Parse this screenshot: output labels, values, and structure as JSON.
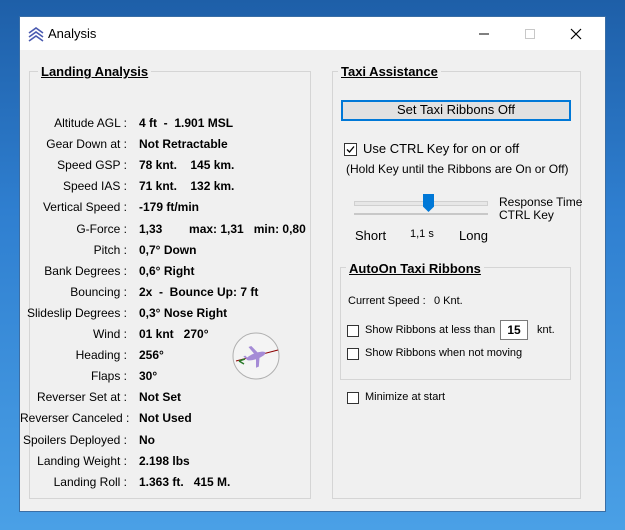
{
  "window": {
    "title": "Analysis"
  },
  "landing": {
    "title": "Landing Analysis",
    "rows": [
      {
        "label": "Altitude AGL :",
        "value": "4 ft  -  1.901 MSL"
      },
      {
        "label": "Gear Down at :",
        "value": "Not Retractable"
      },
      {
        "label": "Speed GSP :",
        "value": "78 knt.    145 km."
      },
      {
        "label": "Speed IAS :",
        "value": "71 knt.    132 km."
      },
      {
        "label": "Vertical Speed :",
        "value": "-179 ft/min"
      },
      {
        "label": "G-Force :",
        "value": "1,33        max: 1,31   min: 0,80"
      },
      {
        "label": "Pitch :",
        "value": "0,7° Down"
      },
      {
        "label": "Bank Degrees :",
        "value": "0,6° Right"
      },
      {
        "label": "Bouncing :",
        "value": "2x  -  Bounce Up: 7 ft"
      },
      {
        "label": "Slideslip Degrees :",
        "value": "0,3° Nose Right"
      },
      {
        "label": "Wind :",
        "value": "01 knt   270°"
      },
      {
        "label": "Heading :",
        "value": "256°"
      },
      {
        "label": "Flaps :",
        "value": "30°"
      },
      {
        "label": "Reverser Set at :",
        "value": "Not Set"
      },
      {
        "label": "Reverser Canceled :",
        "value": "Not Used"
      },
      {
        "label": "Spoilers Deployed :",
        "value": "No"
      },
      {
        "label": "Landing Weight :",
        "value": "2.198 lbs"
      },
      {
        "label": "Landing Roll :",
        "value": "1.363 ft.   415 M."
      }
    ]
  },
  "taxi": {
    "title": "Taxi Assistance",
    "set_button": "Set Taxi Ribbons Off",
    "ctrl_checkbox_label": "Use CTRL Key for on or off",
    "ctrl_checked": true,
    "hold_hint": "(Hold Key until the Ribbons are On or Off)",
    "response_label_1": "Response Time",
    "response_label_2": "CTRL Key",
    "slider_short": "Short",
    "slider_value": "1,1 s",
    "slider_long": "Long",
    "slider_fraction": 0.55
  },
  "autoon": {
    "title": "AutoOn Taxi Ribbons",
    "current_speed_label": "Current Speed :",
    "current_speed_value": "0 Knt.",
    "show_less_label": "Show Ribbons at less than",
    "show_less_value": "15",
    "show_less_unit": "knt.",
    "show_not_moving_label": "Show Ribbons when not moving"
  },
  "minimize_label": "Minimize at start"
}
